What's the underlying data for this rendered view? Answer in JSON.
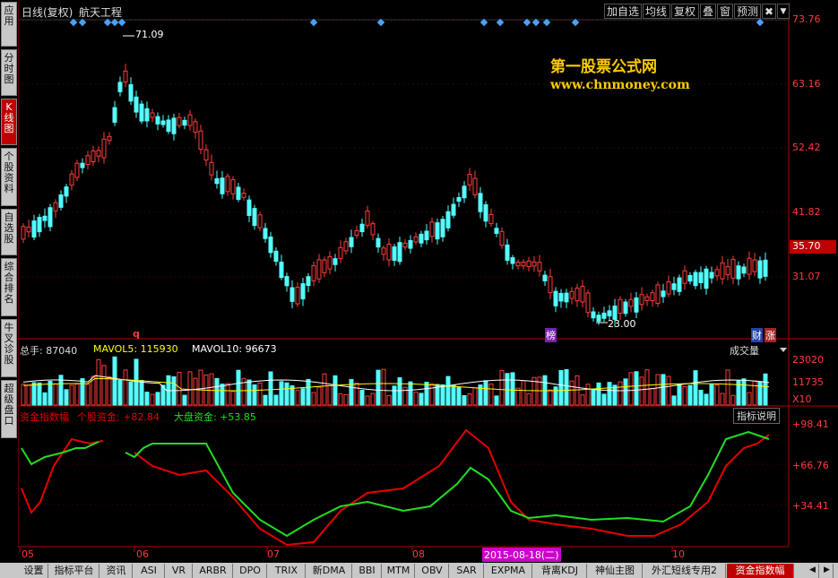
{
  "window": {
    "period_label": "日线(复权)",
    "stock_name": "航天工程"
  },
  "toolbar": {
    "buttons": [
      "加自选",
      "均线",
      "复权",
      "叠",
      "窗",
      "预测"
    ],
    "close": "✖",
    "menu": "▼"
  },
  "sidebar": {
    "tabs": [
      "应用",
      "分时图",
      "K线图",
      "个股资料",
      "自选股",
      "综合排名",
      "牛叉诊股",
      "超级盘口"
    ],
    "active_index": 2
  },
  "watermark": {
    "line1": "第一股票公式网",
    "line2": "www.chnmoney.com"
  },
  "price_axis": {
    "labels": [
      "73.76",
      "63.16",
      "52.42",
      "41.82",
      "31.07"
    ],
    "current": "35.70"
  },
  "annotations": {
    "high": "71.09",
    "low": "23.00",
    "q_mark": "q",
    "bang": "榜",
    "cai": "财",
    "zhang": "涨"
  },
  "volume_panel": {
    "label_total": "总手: 87040",
    "label_ma5": "MAVOL5: 115930",
    "label_ma10": "MAVOL10: 96673",
    "selector": "成交量",
    "axis": [
      "23020",
      "11735"
    ],
    "unit": "X10"
  },
  "fund_panel": {
    "title": "资金指数幅",
    "stock_fund": "个股资金: +82.84",
    "market_fund": "大盘资金: +53.85",
    "help": "指标说明",
    "axis": [
      "+98.41",
      "+66.76",
      "+34.41"
    ]
  },
  "time_axis": {
    "months": [
      "05",
      "06",
      "07",
      "08",
      "10"
    ],
    "highlight_date": "2015-08-18(二)"
  },
  "bottom_tabs": [
    "设置",
    "指标平台",
    "资讯",
    "ASI",
    "VR",
    "ARBR",
    "DPO",
    "TRIX",
    "新DMA",
    "BBI",
    "MTM",
    "OBV",
    "SAR",
    "EXPMA",
    "背离KDJ",
    "神仙主图",
    "外汇短线专用2",
    "资金指数幅"
  ],
  "active_bottom_tab": "资金指数幅",
  "colors": {
    "up": "#ff3c3c",
    "down": "#54ffff",
    "ma5": "#ffffff",
    "ma10": "#ffff00",
    "axis": "#b00000",
    "stock_fund": "#e60000",
    "market_fund": "#22dd22",
    "highlight": "#cc00cc"
  }
}
